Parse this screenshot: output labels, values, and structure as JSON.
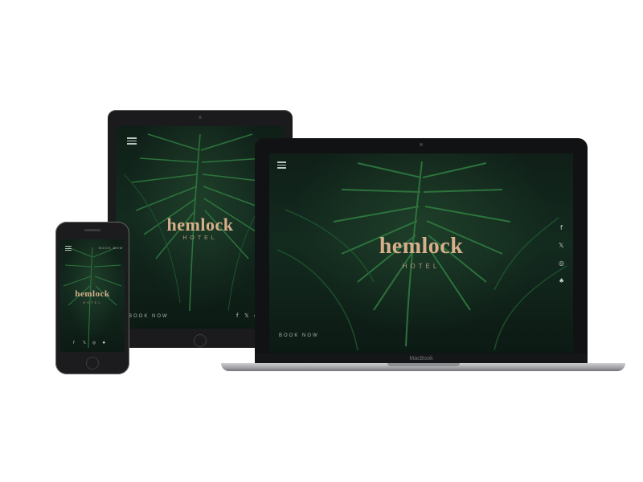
{
  "brand": {
    "name": "hemlock",
    "subtitle": "HOTEL"
  },
  "nav": {
    "book_label": "BOOK NOW",
    "phone_book_label": "BOOK NOW",
    "tablet_book_label": "BOOK NOW"
  },
  "laptop": {
    "model_label": "MacBook"
  },
  "social": {
    "facebook": "f",
    "twitter": "𝕏",
    "instagram": "◎",
    "snapchat": "♠"
  },
  "colors": {
    "accent": "#d7b08b",
    "screen_dark": "#0f1f18"
  },
  "icons": [
    "menu-icon",
    "facebook-icon",
    "twitter-icon",
    "instagram-icon",
    "snapchat-icon",
    "home-button-icon",
    "camera-icon"
  ]
}
